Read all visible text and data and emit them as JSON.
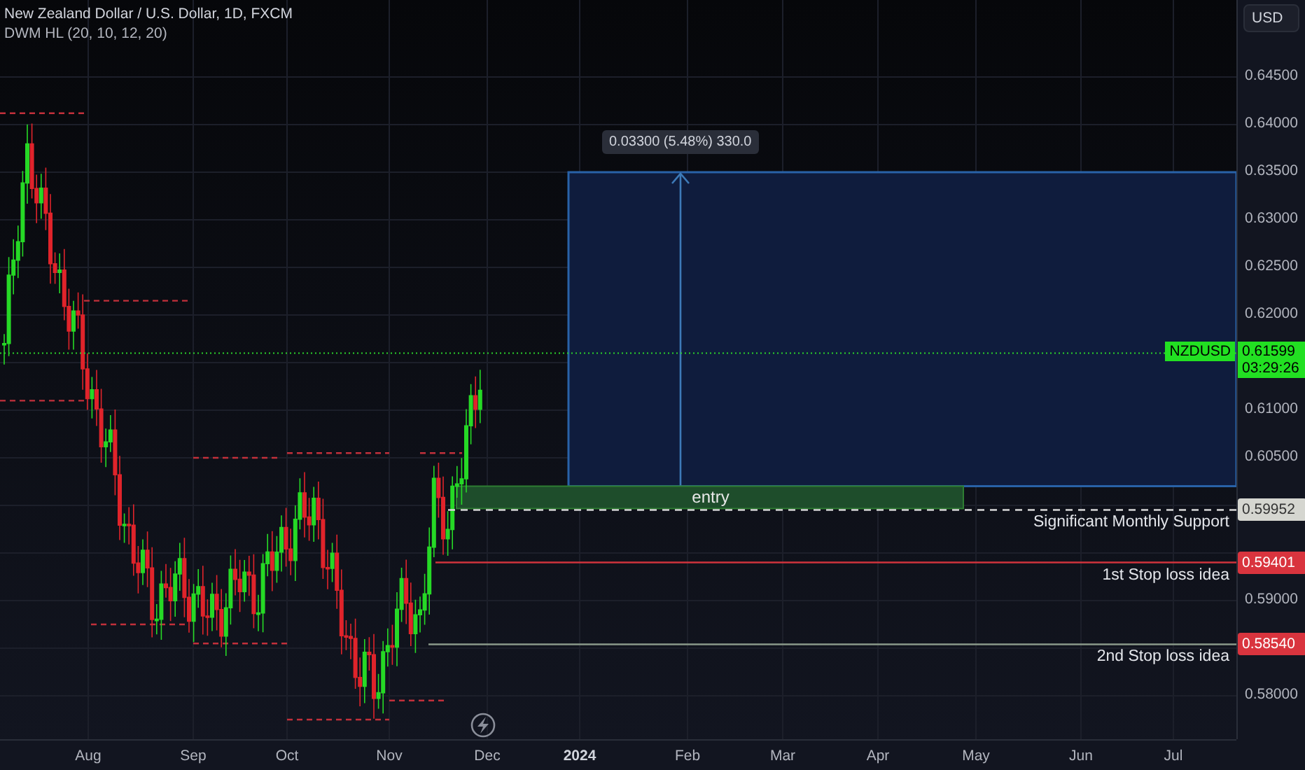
{
  "header": {
    "title": "New Zealand Dollar / U.S. Dollar, 1D, FXCM",
    "indicator": "DWM HL (20, 10, 12, 20)"
  },
  "currency_button": "USD",
  "price_axis": {
    "ticks": [
      "0.64500",
      "0.64000",
      "0.63500",
      "0.63000",
      "0.62500",
      "0.62000",
      "0.61000",
      "0.60500",
      "0.59000",
      "0.58000"
    ]
  },
  "time_axis": {
    "ticks": [
      {
        "label": "Aug",
        "bold": false
      },
      {
        "label": "Sep",
        "bold": false
      },
      {
        "label": "Oct",
        "bold": false
      },
      {
        "label": "Nov",
        "bold": false
      },
      {
        "label": "Dec",
        "bold": false
      },
      {
        "label": "2024",
        "bold": true
      },
      {
        "label": "Feb",
        "bold": false
      },
      {
        "label": "Mar",
        "bold": false
      },
      {
        "label": "Apr",
        "bold": false
      },
      {
        "label": "May",
        "bold": false
      },
      {
        "label": "Jun",
        "bold": false
      },
      {
        "label": "Jul",
        "bold": false
      }
    ]
  },
  "current_price": {
    "symbol": "NZDUSD",
    "price": "0.61599",
    "countdown": "03:29:26"
  },
  "position_tool": {
    "measure": "0.03300 (5.48%) 330.0"
  },
  "entry_zone": {
    "label": "entry"
  },
  "levels": [
    {
      "label": "Significant Monthly Support",
      "price": "0.59952",
      "kind": "support"
    },
    {
      "label": "1st Stop loss idea",
      "price": "0.59401",
      "kind": "stop"
    },
    {
      "label": "2nd Stop loss idea",
      "price": "0.58540",
      "kind": "stop"
    }
  ]
}
